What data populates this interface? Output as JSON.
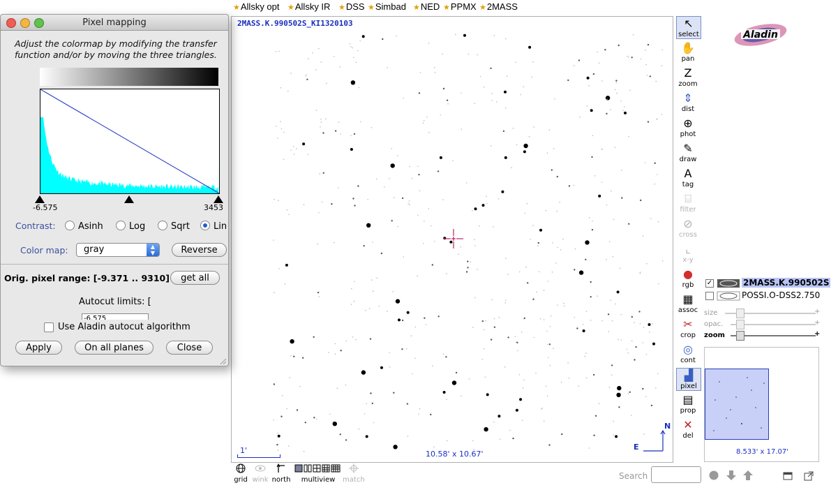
{
  "topbar": {
    "items": [
      "Allsky opt",
      "Allsky IR",
      "DSS",
      "Simbad",
      "NED",
      "PPMX",
      "2MASS"
    ]
  },
  "view": {
    "title": "2MASS.K.990502S_KI1320103",
    "size": "10.58' x 10.67'",
    "scale_label": "1'",
    "compass_n": "N",
    "compass_e": "E"
  },
  "tools": [
    {
      "label": "select",
      "icon": "cursor-arrow-icon",
      "glyph": "↖"
    },
    {
      "label": "pan",
      "icon": "hand-icon",
      "glyph": "✋"
    },
    {
      "label": "zoom",
      "icon": "zoom-z-icon",
      "glyph": "Z"
    },
    {
      "label": "dist",
      "icon": "distance-icon",
      "glyph": "⇕"
    },
    {
      "label": "phot",
      "icon": "photometry-icon",
      "glyph": "⊕"
    },
    {
      "label": "draw",
      "icon": "pencil-icon",
      "glyph": "✎"
    },
    {
      "label": "tag",
      "icon": "tag-icon",
      "glyph": "A"
    },
    {
      "label": "filter",
      "icon": "filter-icon",
      "glyph": "⌸"
    },
    {
      "label": "cross",
      "icon": "cross-match-icon",
      "glyph": "⊘"
    },
    {
      "label": "x-y",
      "icon": "xy-plot-icon",
      "glyph": "⌞"
    },
    {
      "label": "rgb",
      "icon": "rgb-icon",
      "glyph": "●"
    },
    {
      "label": "assoc",
      "icon": "film-strip-icon",
      "glyph": "▦"
    },
    {
      "label": "crop",
      "icon": "scissors-icon",
      "glyph": "✂"
    },
    {
      "label": "cont",
      "icon": "contour-icon",
      "glyph": "◎"
    },
    {
      "label": "pixel",
      "icon": "pixel-histogram-icon",
      "glyph": "▟"
    },
    {
      "label": "prop",
      "icon": "properties-icon",
      "glyph": "▤"
    },
    {
      "label": "del",
      "icon": "delete-x-icon",
      "glyph": "✕"
    }
  ],
  "planes": [
    {
      "name": "2MASS.K.990502S",
      "checked": true
    },
    {
      "name": "POSSI.O-DSS2.750",
      "checked": false
    }
  ],
  "sliders": {
    "size": "size",
    "opacity": "opac.",
    "zoom": "zoom"
  },
  "overview": {
    "size": "8.533' x 17.07'"
  },
  "bottom_toolbar": {
    "grid": "grid",
    "wink": "wink",
    "north": "north",
    "multiview": "multiview",
    "match": "match",
    "search_label": "Search"
  },
  "dialog": {
    "title": "Pixel mapping",
    "description": "Adjust the colormap by modifying the transfer function and/or by moving the three triangles.",
    "range_min": "-6.575",
    "range_max": "3453",
    "contrast_label": "Contrast:",
    "contrast_options": [
      "Asinh",
      "Log",
      "Sqrt",
      "Lin"
    ],
    "contrast_selected": "Lin",
    "colormap_label": "Color map:",
    "colormap_value": "gray",
    "reverse_button": "Reverse",
    "orig_range": "Orig. pixel range: [-9.371 .. 9310]",
    "get_all_button": "get all",
    "autocut_label": "Autocut limits: [",
    "autocut_value": "-6.575",
    "aladin_autocut_label": "Use Aladin autocut algorithm",
    "apply_button": "Apply",
    "all_planes_button": "On all planes",
    "close_button": "Close"
  },
  "colors": {
    "accent_blue": "#1a2fbf",
    "histogram": "#00ffff",
    "transfer_line": "#1a2fbf",
    "reticle": "#c0206a"
  }
}
